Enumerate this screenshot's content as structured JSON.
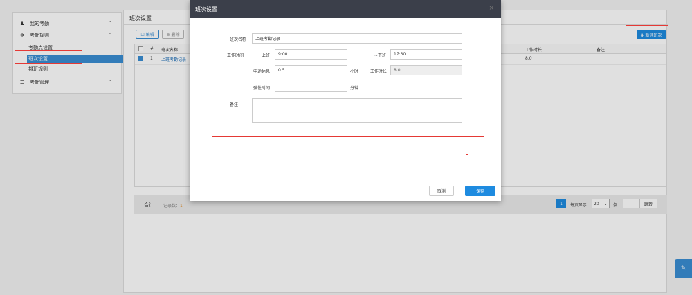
{
  "sidebar": {
    "items": [
      {
        "label": "我的考勤",
        "icon": "user-icon",
        "chevron": "˅"
      },
      {
        "label": "考勤规则",
        "icon": "gear-icon",
        "chevron": "˄"
      },
      {
        "label": "考勤管理",
        "icon": "list-icon",
        "chevron": "˅"
      }
    ],
    "sub_items": [
      "考勤点设置",
      "班次设置",
      "排班规则"
    ]
  },
  "content": {
    "title": "班次设置",
    "edit_label": "☑ 编辑",
    "delete_label": "⊗ 删除",
    "new_label": "✚ 新建班次",
    "table": {
      "headers": {
        "index": "#",
        "name": "班次名称",
        "work_hours": "工作时长",
        "remark": "备注"
      },
      "rows": [
        {
          "index": "1",
          "name": "上班考勤记录",
          "work_hours": "8.0",
          "remark": ""
        }
      ]
    },
    "footer": {
      "sum_label": "合计",
      "count_label": "记录数：",
      "count_value": "1",
      "page": "1",
      "per_page_label": "每页显示",
      "per_page_value": "20",
      "unit_label": "条",
      "go_label": "跳转"
    }
  },
  "modal": {
    "title": "班次设置",
    "close": "×",
    "name_label": "班次名称",
    "name_value": "上班考勤记录",
    "work_time_label": "工作时间",
    "start_label": "上班",
    "start_value": "9:00",
    "end_label": "~下班",
    "end_value": "17:30",
    "break_label": "中途休息",
    "break_value": "0.5",
    "hour_unit": "小时",
    "duration_label": "工作时长",
    "duration_value": "8.0",
    "flex_label": "弹性时间",
    "flex_value": "",
    "minute_unit": "分钟",
    "remark_label": "备注",
    "remark_value": "",
    "cancel_label": "取消",
    "save_label": "保存"
  },
  "colors": {
    "primary": "#1e8be0",
    "modal_header": "#3b3f4a",
    "annotation": "#e53935"
  },
  "float_icon": "edit-icon",
  "float_glyph": "✎"
}
